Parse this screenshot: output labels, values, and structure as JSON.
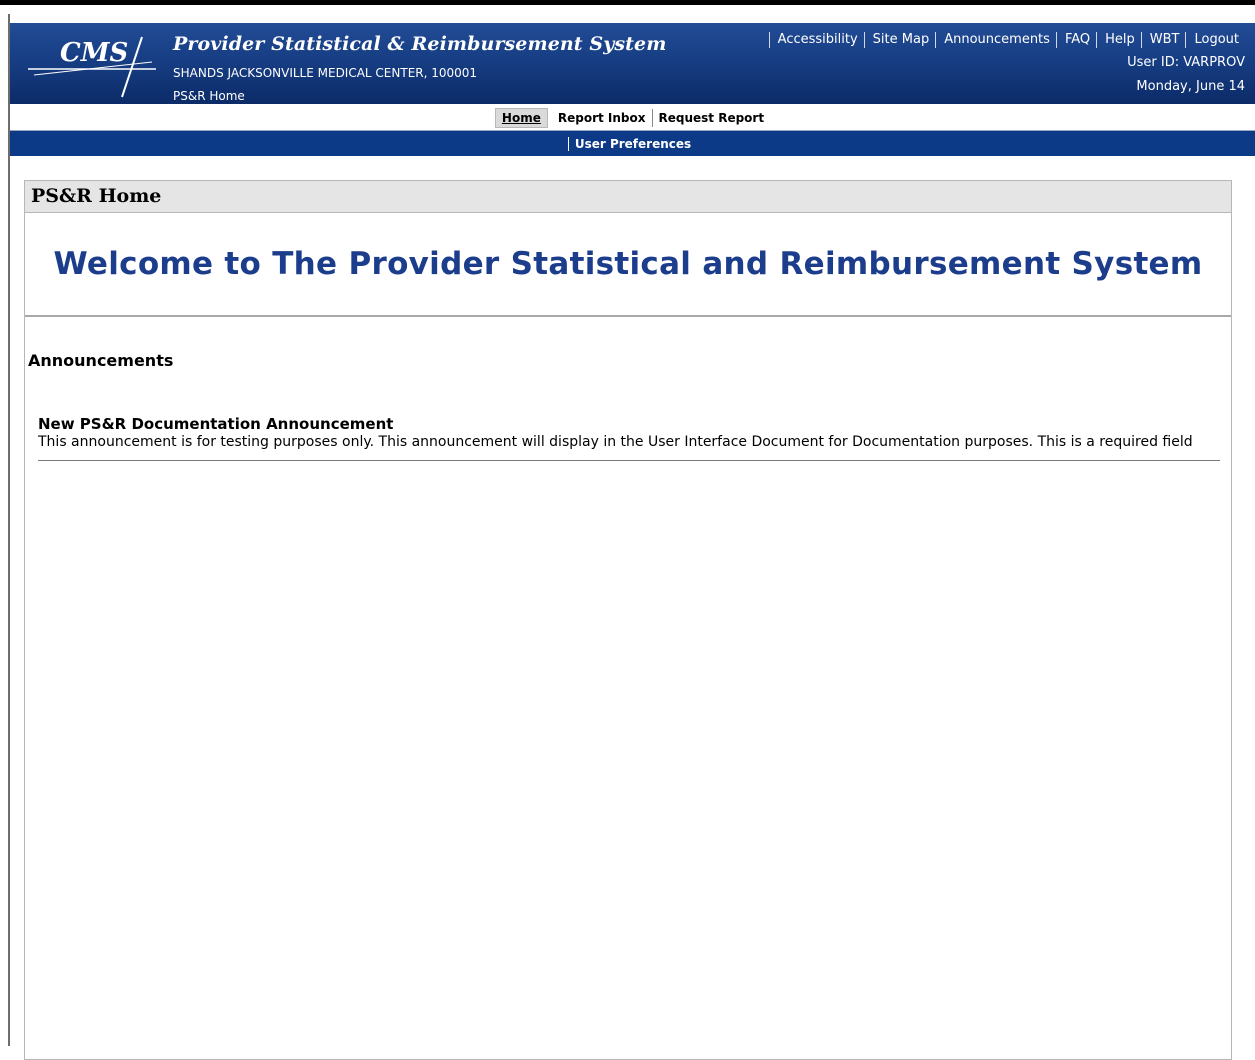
{
  "header": {
    "logo_text": "CMS",
    "app_title": "Provider Statistical & Reimbursement System",
    "provider": "SHANDS JACKSONVILLE MEDICAL CENTER, 100001",
    "breadcrumb": "PS&R Home",
    "links": [
      "Accessibility",
      "Site Map",
      "Announcements",
      "FAQ",
      "Help",
      "WBT",
      "Logout"
    ],
    "user_id": "User ID: VARPROV",
    "date": "Monday, June 14"
  },
  "nav": {
    "primary": [
      "Home",
      "Report Inbox",
      "Request Report"
    ],
    "active": "Home",
    "secondary": [
      "User Preferences"
    ]
  },
  "page": {
    "title": "PS&R Home",
    "welcome": "Welcome to The Provider Statistical and Reimbursement System"
  },
  "announcements": {
    "heading": "Announcements",
    "items": [
      {
        "title": "New PS&R Documentation Announcement",
        "body": "This announcement is for testing purposes only. This announcement will display in the User Interface Document for Documentation purposes. This is a required field"
      }
    ]
  },
  "colors": {
    "header_blue": "#173e84",
    "nav_blue": "#0c3a86",
    "welcome_blue": "#1b3d8c"
  }
}
